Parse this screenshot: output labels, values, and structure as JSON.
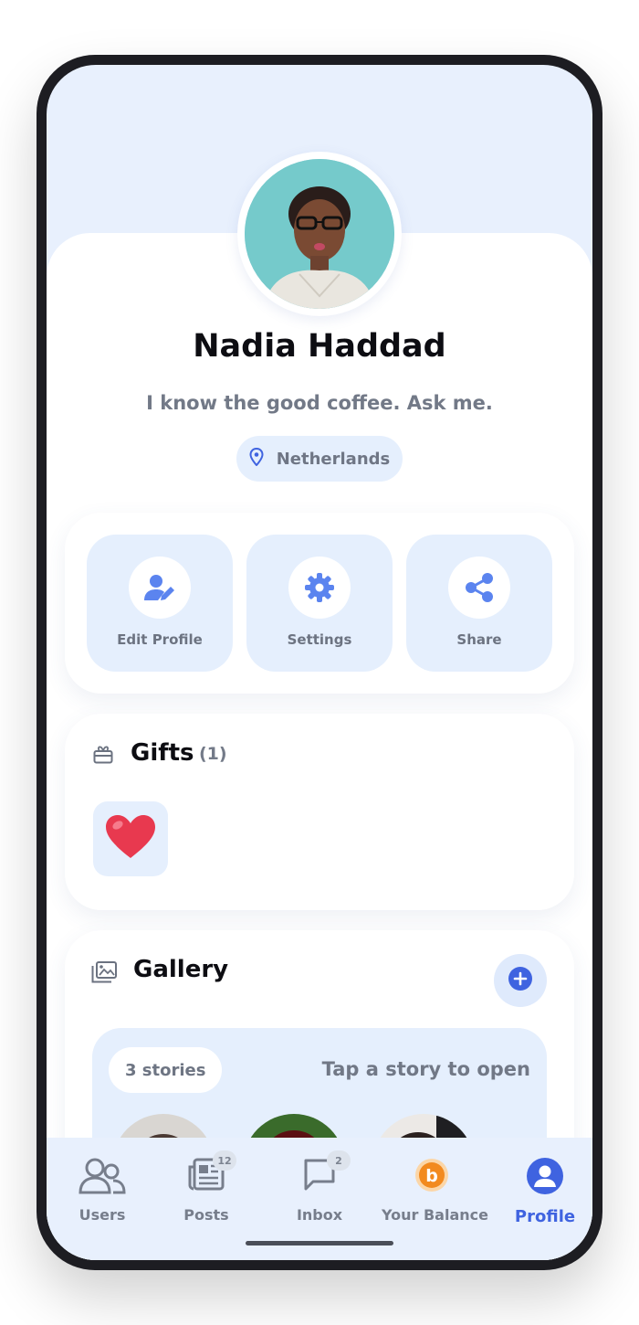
{
  "profile": {
    "name": "Nadia Haddad",
    "bio": "I know the good coffee. Ask me.",
    "location": "Netherlands"
  },
  "actions": [
    {
      "label": "Edit Profile",
      "icon": "user-edit-icon"
    },
    {
      "label": "Settings",
      "icon": "gear-icon"
    },
    {
      "label": "Share",
      "icon": "share-icon"
    }
  ],
  "gifts": {
    "title": "Gifts",
    "count": "(1)",
    "items": [
      {
        "icon": "heart-icon"
      }
    ]
  },
  "gallery": {
    "title": "Gallery",
    "stories_count": "3 stories",
    "hint": "Tap a story to open"
  },
  "tabs": [
    {
      "label": "Users",
      "icon": "users-icon",
      "badge": null
    },
    {
      "label": "Posts",
      "icon": "newspaper-icon",
      "badge": "12"
    },
    {
      "label": "Inbox",
      "icon": "chat-icon",
      "badge": "2"
    },
    {
      "label": "Your Balance",
      "icon": "coin-icon",
      "badge": null
    },
    {
      "label": "Profile",
      "icon": "profile-icon",
      "badge": null,
      "active": true
    }
  ],
  "colors": {
    "accent": "#3f63e0",
    "tint": "#e5effd",
    "heart": "#e8394f",
    "coin": "#f28a1f"
  }
}
